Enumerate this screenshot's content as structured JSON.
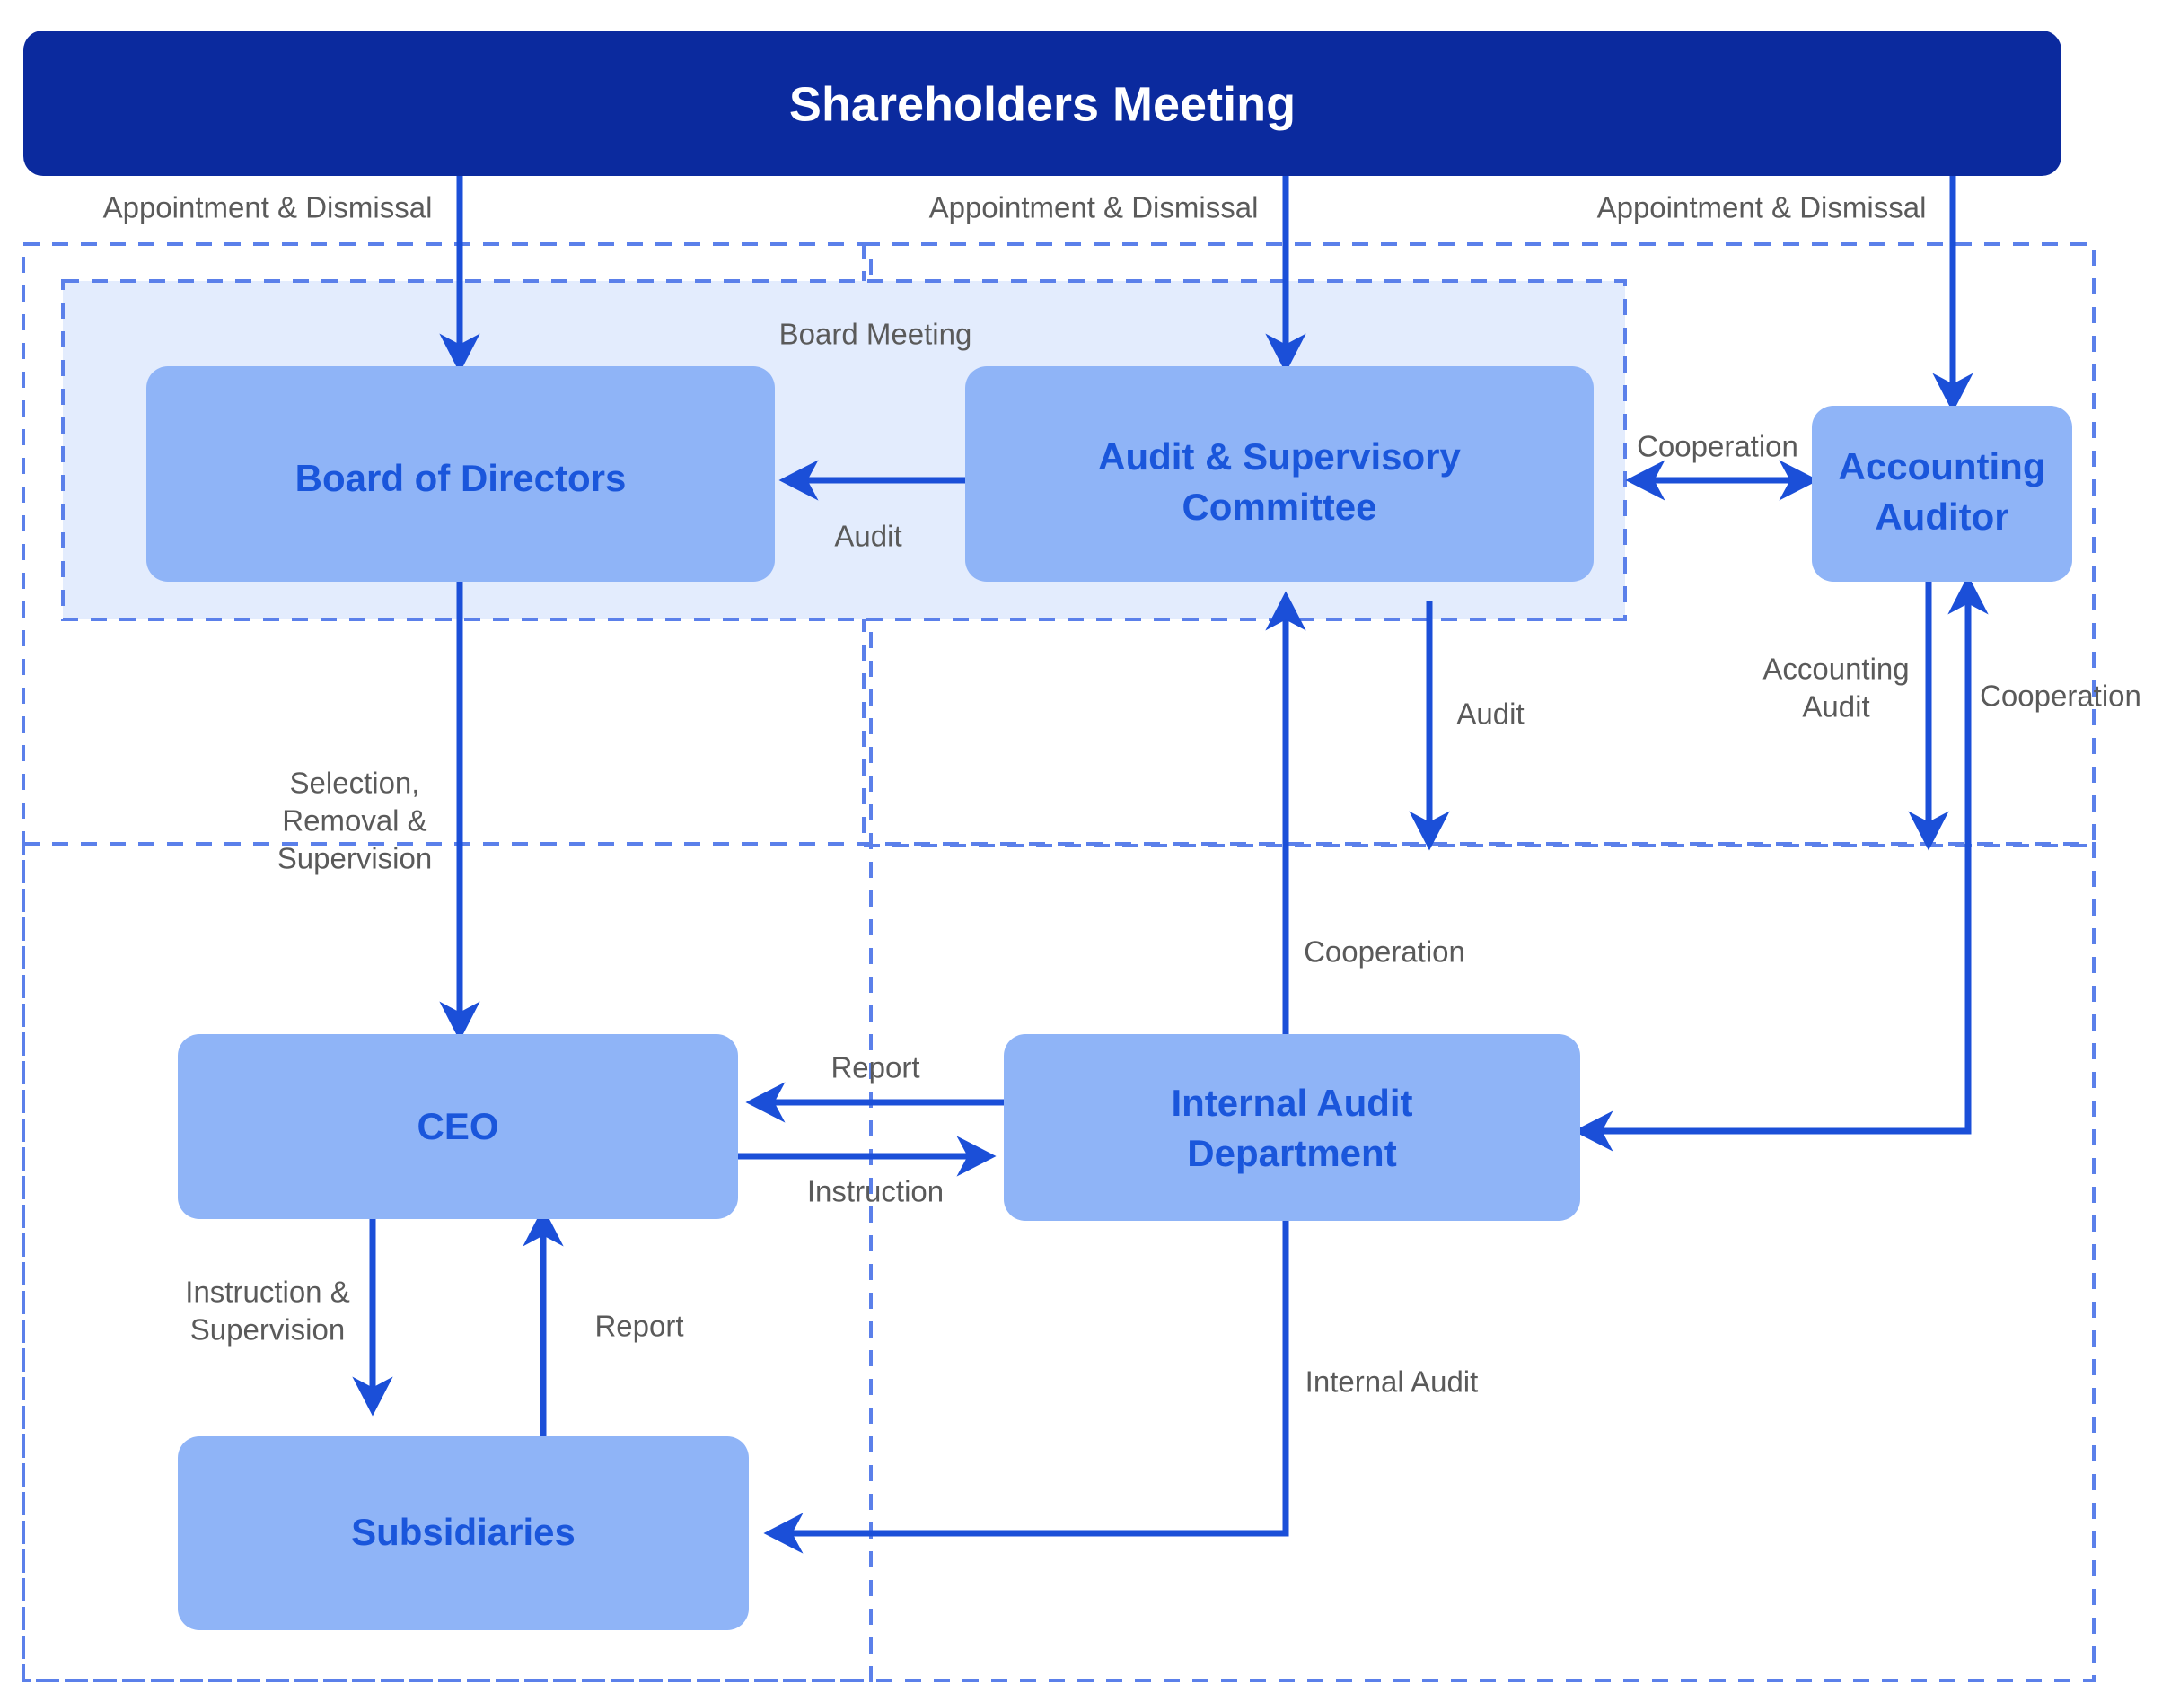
{
  "diagram": {
    "title_node": {
      "label": "Shareholders Meeting"
    },
    "colors": {
      "header_fill": "#0b2a9e",
      "node_fill": "#8fb4f7",
      "node_text": "#1a56db",
      "zone_fill": "#e3ecfd",
      "dashed_stroke": "#5b80ea",
      "arrow_stroke": "#1b4fd8",
      "label_text": "#5a5a5a",
      "page_background": "#ffffff"
    },
    "zones": [
      {
        "id": "board-meeting-zone",
        "label": "Board Meeting"
      },
      {
        "id": "company-outer-zone",
        "label": ""
      },
      {
        "id": "group-outer-zone",
        "label": ""
      }
    ],
    "nodes": [
      {
        "id": "shareholders-meeting",
        "label": "Shareholders Meeting"
      },
      {
        "id": "board-of-directors",
        "label": "Board of Directors"
      },
      {
        "id": "audit-supervisory-committee",
        "label": "Audit & Supervisory\nCommittee",
        "line1": "Audit & Supervisory",
        "line2": "Committee"
      },
      {
        "id": "accounting-auditor",
        "label": "Accounting\nAuditor",
        "line1": "Accounting",
        "line2": "Auditor"
      },
      {
        "id": "ceo",
        "label": "CEO"
      },
      {
        "id": "internal-audit-department",
        "label": "Internal Audit\nDepartment",
        "line1": "Internal Audit",
        "line2": "Department"
      },
      {
        "id": "subsidiaries",
        "label": "Subsidiaries"
      }
    ],
    "edge_labels": {
      "appointment_dismissal_bod": "Appointment & Dismissal",
      "appointment_dismissal_asc": "Appointment & Dismissal",
      "appointment_dismissal_aa": "Appointment & Dismissal",
      "audit_asc_to_bod": "Audit",
      "cooperation_asc_aa": "Cooperation",
      "audit_asc_to_iad": "Audit",
      "accounting_audit": "Accounting\nAudit",
      "accounting_audit_line1": "Accounting",
      "accounting_audit_line2": "Audit",
      "cooperation_aa_iad": "Cooperation",
      "selection_removal_supervision": "Selection,\nRemoval &\nSupervision",
      "selection_line1": "Selection,",
      "selection_line2": "Removal &",
      "selection_line3": "Supervision",
      "cooperation_iad_asc": "Cooperation",
      "report_iad_ceo": "Report",
      "instruction_ceo_iad": "Instruction",
      "instruction_supervision_ceo_sub": "Instruction &\nSupervision",
      "instruction_supervision_line1": "Instruction &",
      "instruction_supervision_line2": "Supervision",
      "report_sub_ceo": "Report",
      "internal_audit_iad_sub": "Internal Audit"
    }
  }
}
